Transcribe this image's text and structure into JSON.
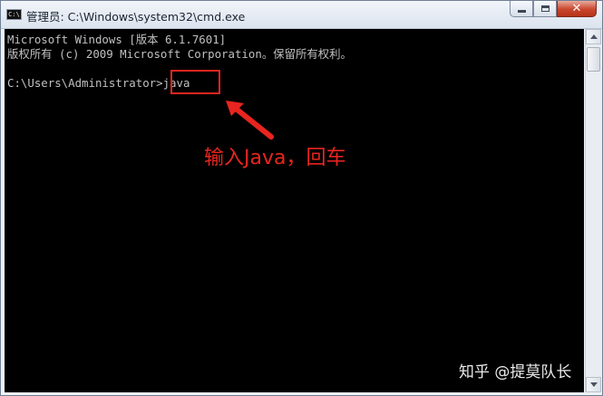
{
  "window": {
    "title": "管理员: C:\\Windows\\system32\\cmd.exe",
    "icon": "cmd-icon"
  },
  "caption_buttons": {
    "minimize": "minimize-icon",
    "maximize": "maximize-icon",
    "close": "close-icon",
    "close_glyph": "✕"
  },
  "console": {
    "lines": [
      "Microsoft Windows [版本 6.1.7601]",
      "版权所有 (c) 2009 Microsoft Corporation。保留所有权利。",
      "",
      "C:\\Users\\Administrator>java"
    ],
    "background": "#000000",
    "text_color": "#c0c0c0"
  },
  "annotation": {
    "text": "输入Java，回车",
    "color": "#e8251f"
  },
  "watermark": {
    "text": "知乎 @提莫队长"
  }
}
